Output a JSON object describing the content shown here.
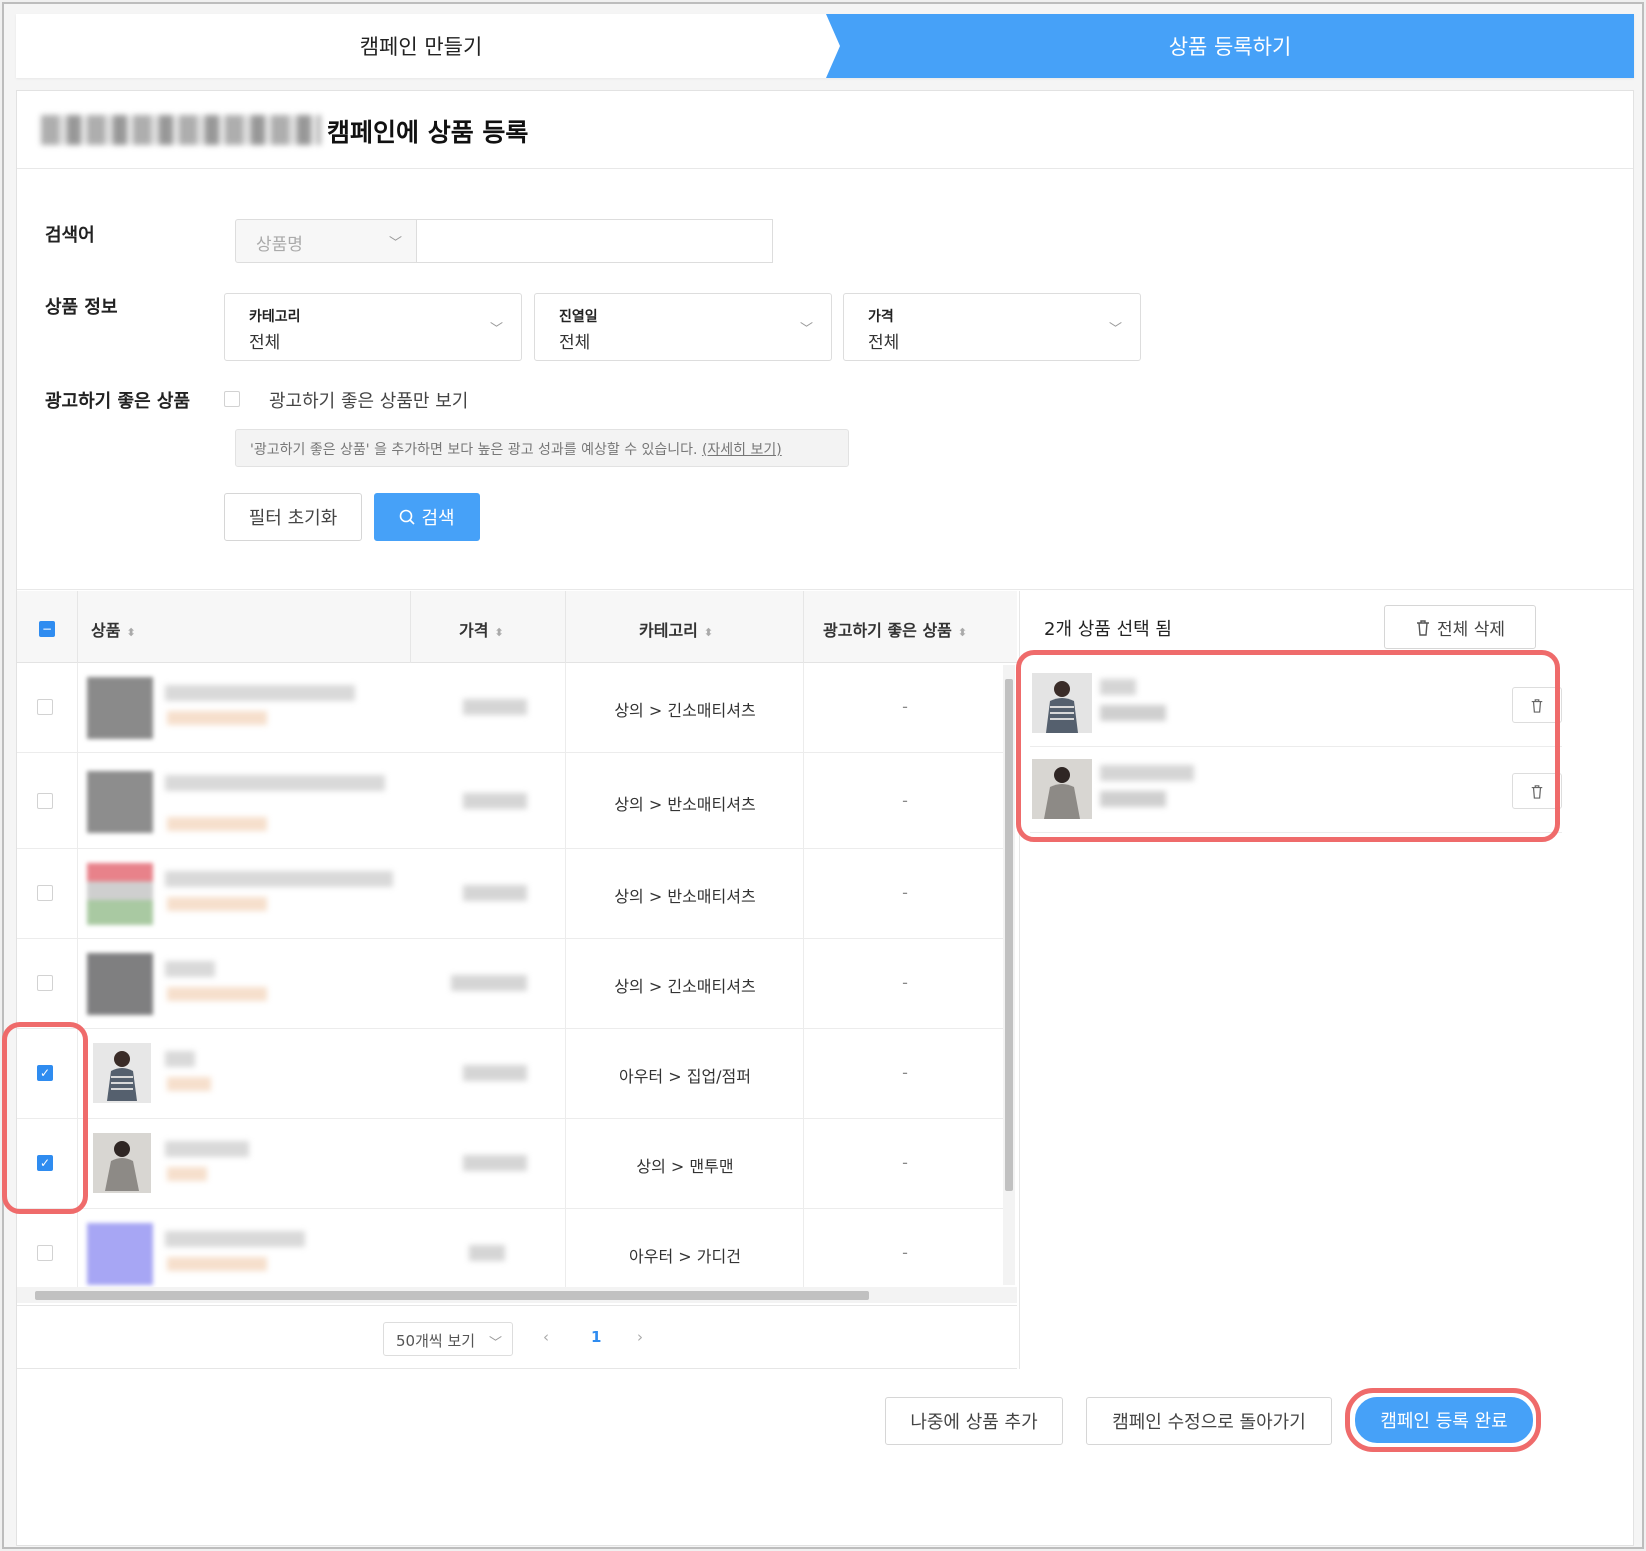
{
  "steps": {
    "step1": "캠페인 만들기",
    "step2": "상품 등록하기"
  },
  "page_title": "캠페인에 상품 등록",
  "filters": {
    "keyword_label": "검색어",
    "keyword_select": "상품명",
    "info_label": "상품 정보",
    "dropdowns": [
      {
        "title": "카테고리",
        "value": "전체"
      },
      {
        "title": "진열일",
        "value": "전체"
      },
      {
        "title": "가격",
        "value": "전체"
      }
    ],
    "good_label": "광고하기 좋은 상품",
    "good_only": "광고하기 좋은 상품만 보기",
    "notice": "'광고하기 좋은 상품' 을 추가하면 보다 높은 광고 성과를 예상할 수 있습니다.",
    "notice_link": "(자세히 보기)",
    "reset": "필터 초기화",
    "search": "검색"
  },
  "table": {
    "headers": [
      "상품",
      "가격",
      "카테고리",
      "광고하기 좋은 상품"
    ],
    "rows": [
      {
        "category": "상의 > 긴소매티셔츠",
        "good": "-",
        "checked": false
      },
      {
        "category": "상의 > 반소매티셔츠",
        "good": "-",
        "checked": false
      },
      {
        "category": "상의 > 반소매티셔츠",
        "good": "-",
        "checked": false
      },
      {
        "category": "상의 > 긴소매티셔츠",
        "good": "-",
        "checked": false
      },
      {
        "category": "아우터 > 집업/점퍼",
        "good": "-",
        "checked": true
      },
      {
        "category": "상의 > 맨투맨",
        "good": "-",
        "checked": true
      },
      {
        "category": "아우터 > 가디건",
        "good": "-",
        "checked": false
      }
    ]
  },
  "pagination": {
    "per_page": "50개씩 보기",
    "current": "1"
  },
  "selected": {
    "header": "2개 상품 선택 됨",
    "clear_all": "전체 삭제"
  },
  "footer": {
    "later": "나중에 상품 추가",
    "back": "캠페인 수정으로 돌아가기",
    "done": "캠페인 등록 완료"
  },
  "colors": {
    "accent": "#46a1f8",
    "highlight": "#ef6b6b"
  }
}
